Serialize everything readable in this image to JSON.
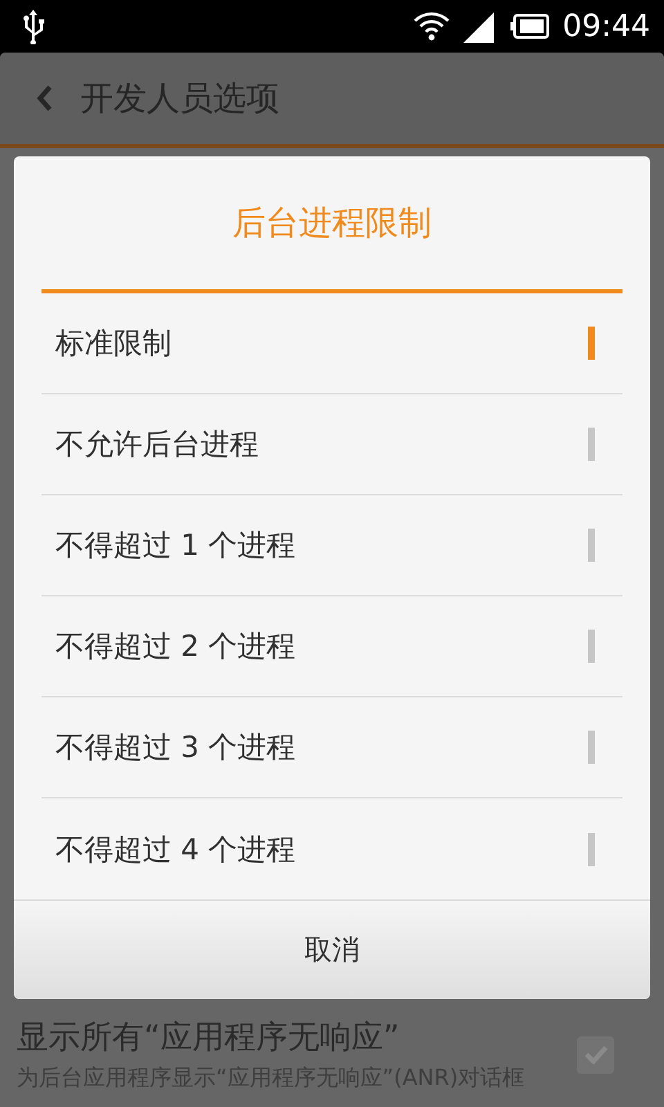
{
  "status_bar": {
    "time": "09:44"
  },
  "header": {
    "title": "开发人员选项"
  },
  "background_setting": {
    "title": "显示所有“应用程序无响应”",
    "description": "为后台应用程序显示“应用程序无响应”(ANR)对话框",
    "checked": true
  },
  "dialog": {
    "title": "后台进程限制",
    "options": [
      {
        "label": "标准限制",
        "selected": true
      },
      {
        "label": "不允许后台进程",
        "selected": false
      },
      {
        "label": "不得超过 1 个进程",
        "selected": false
      },
      {
        "label": "不得超过 2 个进程",
        "selected": false
      },
      {
        "label": "不得超过 3 个进程",
        "selected": false
      },
      {
        "label": "不得超过 4 个进程",
        "selected": false
      }
    ],
    "cancel": "取消"
  }
}
